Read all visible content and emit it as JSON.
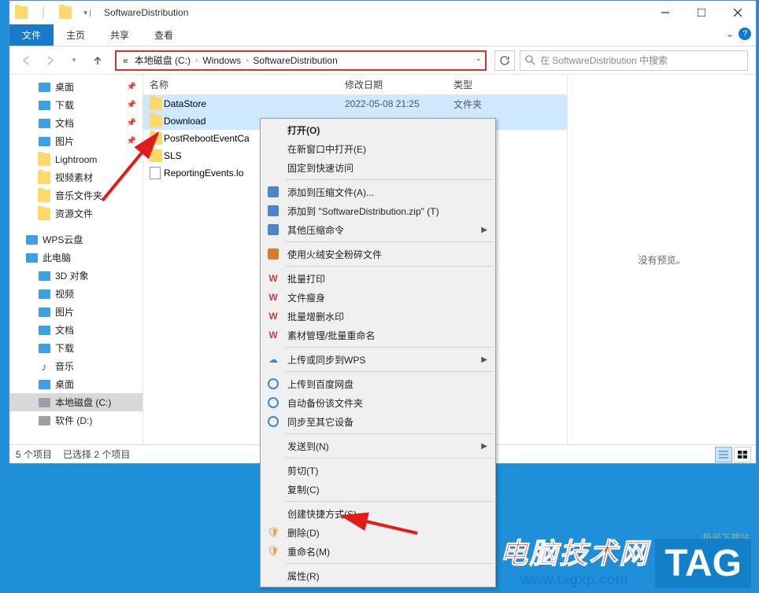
{
  "window": {
    "title": "SoftwareDistribution"
  },
  "tabs": {
    "file": "文件",
    "home": "主页",
    "share": "共享",
    "view": "查看"
  },
  "breadcrumb": {
    "prefix": "«",
    "parts": [
      "本地磁盘 (C:)",
      "Windows",
      "SoftwareDistribution"
    ]
  },
  "search": {
    "placeholder": "在 SoftwareDistribution 中搜索"
  },
  "columns": {
    "name": "名称",
    "date": "修改日期",
    "type": "类型"
  },
  "files": [
    {
      "name": "DataStore",
      "date": "2022-05-08 21:25",
      "type": "文件夹",
      "kind": "folder",
      "selected": true
    },
    {
      "name": "Download",
      "date": "",
      "type": "",
      "kind": "folder",
      "selected": true
    },
    {
      "name": "PostRebootEventCa",
      "date": "",
      "type": "",
      "kind": "folder",
      "selected": false
    },
    {
      "name": "SLS",
      "date": "",
      "type": "",
      "kind": "folder",
      "selected": false
    },
    {
      "name": "ReportingEvents.lo",
      "date": "",
      "type": "",
      "kind": "file",
      "selected": false
    }
  ],
  "tree": [
    {
      "label": "桌面",
      "icon": "desktop",
      "pin": true
    },
    {
      "label": "下载",
      "icon": "download",
      "pin": true
    },
    {
      "label": "文档",
      "icon": "doc",
      "pin": true
    },
    {
      "label": "图片",
      "icon": "pic",
      "pin": true
    },
    {
      "label": "Lightroom",
      "icon": "folder",
      "pin": false
    },
    {
      "label": "视频素材",
      "icon": "folder",
      "pin": false
    },
    {
      "label": "音乐文件夹",
      "icon": "folder",
      "pin": false
    },
    {
      "label": "资源文件",
      "icon": "folder",
      "pin": false
    }
  ],
  "tree2": [
    {
      "label": "WPS云盘",
      "icon": "wps"
    },
    {
      "label": "此电脑",
      "icon": "pc"
    }
  ],
  "tree3": [
    {
      "label": "3D 对象",
      "icon": "3d"
    },
    {
      "label": "视频",
      "icon": "video"
    },
    {
      "label": "图片",
      "icon": "pic"
    },
    {
      "label": "文档",
      "icon": "doc"
    },
    {
      "label": "下载",
      "icon": "download"
    },
    {
      "label": "音乐",
      "icon": "music"
    },
    {
      "label": "桌面",
      "icon": "desktop"
    },
    {
      "label": "本地磁盘 (C:)",
      "icon": "drive",
      "selected": true
    },
    {
      "label": "软件 (D:)",
      "icon": "drive"
    }
  ],
  "preview": {
    "text": "没有预览。"
  },
  "status": {
    "items": "5 个项目",
    "selected": "已选择 2 个项目"
  },
  "context": [
    {
      "t": "打开(O)",
      "bold": true
    },
    {
      "t": "在新窗口中打开(E)"
    },
    {
      "t": "固定到快速访问"
    },
    {
      "sep": true
    },
    {
      "t": "添加到压缩文件(A)...",
      "ico": "zip"
    },
    {
      "t": "添加到 \"SoftwareDistribution.zip\" (T)",
      "ico": "zip"
    },
    {
      "t": "其他压缩命令",
      "ico": "zip2",
      "sub": true
    },
    {
      "sep": true
    },
    {
      "t": "使用火绒安全粉碎文件",
      "ico": "shred"
    },
    {
      "sep": true
    },
    {
      "t": "批量打印",
      "ico": "w"
    },
    {
      "t": "文件瘦身",
      "ico": "w"
    },
    {
      "t": "批量增删水印",
      "ico": "w"
    },
    {
      "t": "素材管理/批量重命名",
      "ico": "w"
    },
    {
      "sep": true
    },
    {
      "t": "上传或同步到WPS",
      "ico": "cloud",
      "sub": true
    },
    {
      "sep": true
    },
    {
      "t": "上传到百度网盘",
      "ico": "bd"
    },
    {
      "t": "自动备份该文件夹",
      "ico": "bd"
    },
    {
      "t": "同步至其它设备",
      "ico": "bd"
    },
    {
      "sep": true
    },
    {
      "t": "发送到(N)",
      "sub": true
    },
    {
      "sep": true
    },
    {
      "t": "剪切(T)"
    },
    {
      "t": "复制(C)"
    },
    {
      "sep": true
    },
    {
      "t": "创建快捷方式(S)"
    },
    {
      "t": "删除(D)",
      "ico": "shield"
    },
    {
      "t": "重命名(M)",
      "ico": "shield"
    },
    {
      "sep": true
    },
    {
      "t": "属性(R)"
    }
  ],
  "watermark": {
    "zh": "电脑技术网",
    "url": "www.tagxp.com",
    "tag": "TAG",
    "corner": "极光下载站"
  }
}
